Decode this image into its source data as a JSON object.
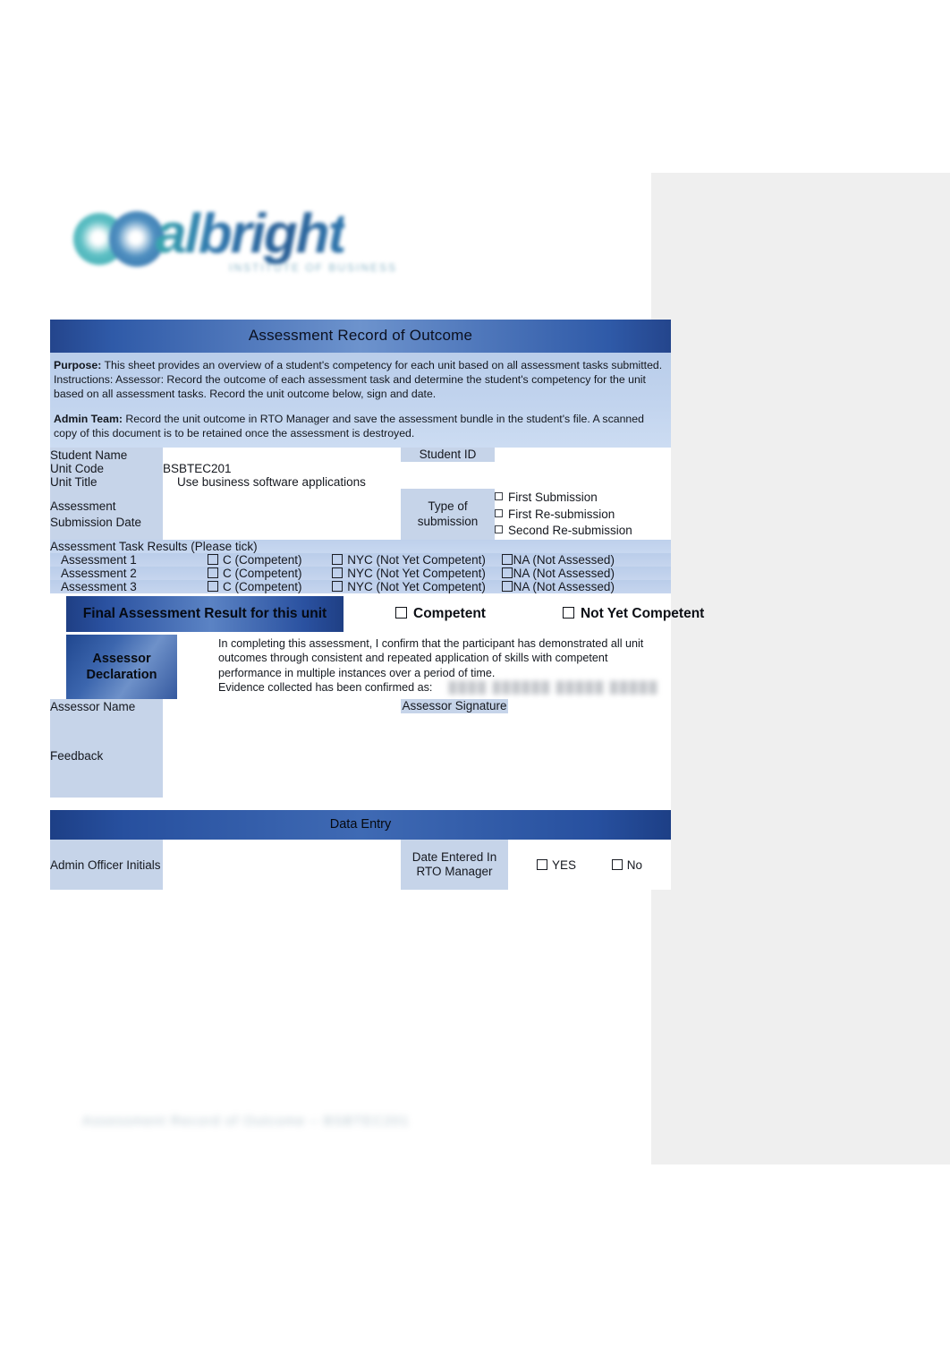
{
  "logo": {
    "wordmark": "albright",
    "tagline": "INSTITUTE OF BUSINESS",
    "mark_primary_color": "#3aa8ae",
    "mark_secondary_color": "#2d6ea8"
  },
  "header": {
    "title": "Assessment Record of Outcome"
  },
  "intro": {
    "purpose_label": "Purpose:",
    "purpose_text": "This sheet provides an overview of a student's competency for each unit based on all assessment tasks submitted.",
    "instructions_text": "Instructions: Assessor: Record the outcome of each assessment task and determine the student's competency for the unit based on all assessment tasks. Record the unit outcome below, sign and date.",
    "admin_label": "Admin Team:",
    "admin_text": "Record the unit outcome in RTO Manager and save the assessment bundle in the student's file. A scanned copy of this document is to be retained once the assessment is destroyed."
  },
  "form": {
    "student_name_label": "Student Name",
    "student_name_value": "",
    "student_id_label": "Student ID",
    "student_id_value": "",
    "unit_code_label": "Unit Code",
    "unit_code_value": "BSBTEC201",
    "unit_title_label": "Unit Title",
    "unit_title_value": "Use business software applications",
    "submission_date_label": "Assessment Submission Date",
    "submission_date_value": "",
    "type_of_submission_label": "Type of submission",
    "submission_options": [
      "First Submission",
      "First Re-submission",
      "Second Re-submission"
    ]
  },
  "task_results": {
    "section_label": "Assessment Task Results (Please tick)",
    "rows": [
      {
        "name": "Assessment 1",
        "options": [
          "C (Competent)",
          "NYC (Not Yet Competent)",
          "NA (Not Assessed)"
        ]
      },
      {
        "name": "Assessment 2",
        "options": [
          "C (Competent)",
          "NYC (Not Yet Competent)",
          "NA (Not Assessed)"
        ]
      },
      {
        "name": "Assessment 3",
        "options": [
          "C (Competent)",
          "NYC (Not Yet Competent)",
          "NA (Not Assessed)"
        ]
      }
    ]
  },
  "final_result": {
    "label": "Final Assessment Result for this unit",
    "option_competent": "Competent",
    "option_not_yet_competent": "Not Yet Competent"
  },
  "assessor_declaration": {
    "label": "Assessor Declaration",
    "text": "In completing this assessment, I confirm that the participant has demonstrated all unit outcomes through consistent and repeated application of skills with competent performance in multiple instances over a period of time.",
    "evidence_line": "Evidence collected has been confirmed as:",
    "evidence_redacted": "████   ██████   █████   █████"
  },
  "assessor": {
    "name_label": "Assessor Name",
    "name_value": "",
    "signature_label": "Assessor Signature",
    "signature_value": "",
    "feedback_label": "Feedback",
    "feedback_value": ""
  },
  "data_entry": {
    "section_title": "Data Entry",
    "admin_initials_label": "Admin Officer Initials",
    "admin_initials_value": "",
    "date_entered_label": "Date Entered In RTO Manager",
    "yes_label": "YES",
    "no_label": "No"
  },
  "footer": {
    "text": "Assessment Record of Outcome – BSBTEC201"
  },
  "colors": {
    "band_dark_blue": "#24458c",
    "band_mid_blue": "#6d93cd",
    "cell_light_blue": "#c6d4e9",
    "intro_blue": "#c2d4ee",
    "page_grey": "#efefef"
  }
}
